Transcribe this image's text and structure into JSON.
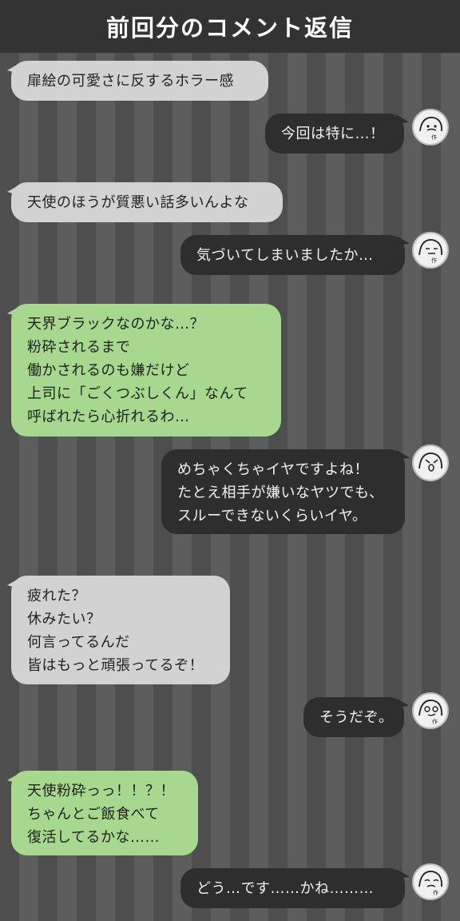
{
  "header": {
    "title": "前回分のコメント返信"
  },
  "messages": [
    {
      "text": "扉絵の可愛さに反するホラー感"
    },
    {
      "text": "今回は特に…！"
    },
    {
      "text": "天使のほうが質悪い話多いんよな"
    },
    {
      "text": "気づいてしまいましたか…"
    },
    {
      "text": "天界ブラックなのかな…？\n粉砕されるまで\n働かされるのも嫌だけど\n上司に「ごくつぶしくん」なんて\n呼ばれたら心折れるわ…"
    },
    {
      "text": "めちゃくちゃイヤですよね！\nたとえ相手が嫌いなヤツでも、\nスルーできないくらいイヤ。"
    },
    {
      "text": "疲れた？\n休みたい？\n何言ってるんだ\n皆はもっと頑張ってるぞ！"
    },
    {
      "text": "そうだぞ。"
    },
    {
      "text": "天使粉砕っっ！！？！\nちゃんとご飯食べて\n復活してるかな……"
    },
    {
      "text": "どう…です……かね………"
    }
  ],
  "avatar": {
    "icon": "author-face-icon",
    "label": "作"
  }
}
